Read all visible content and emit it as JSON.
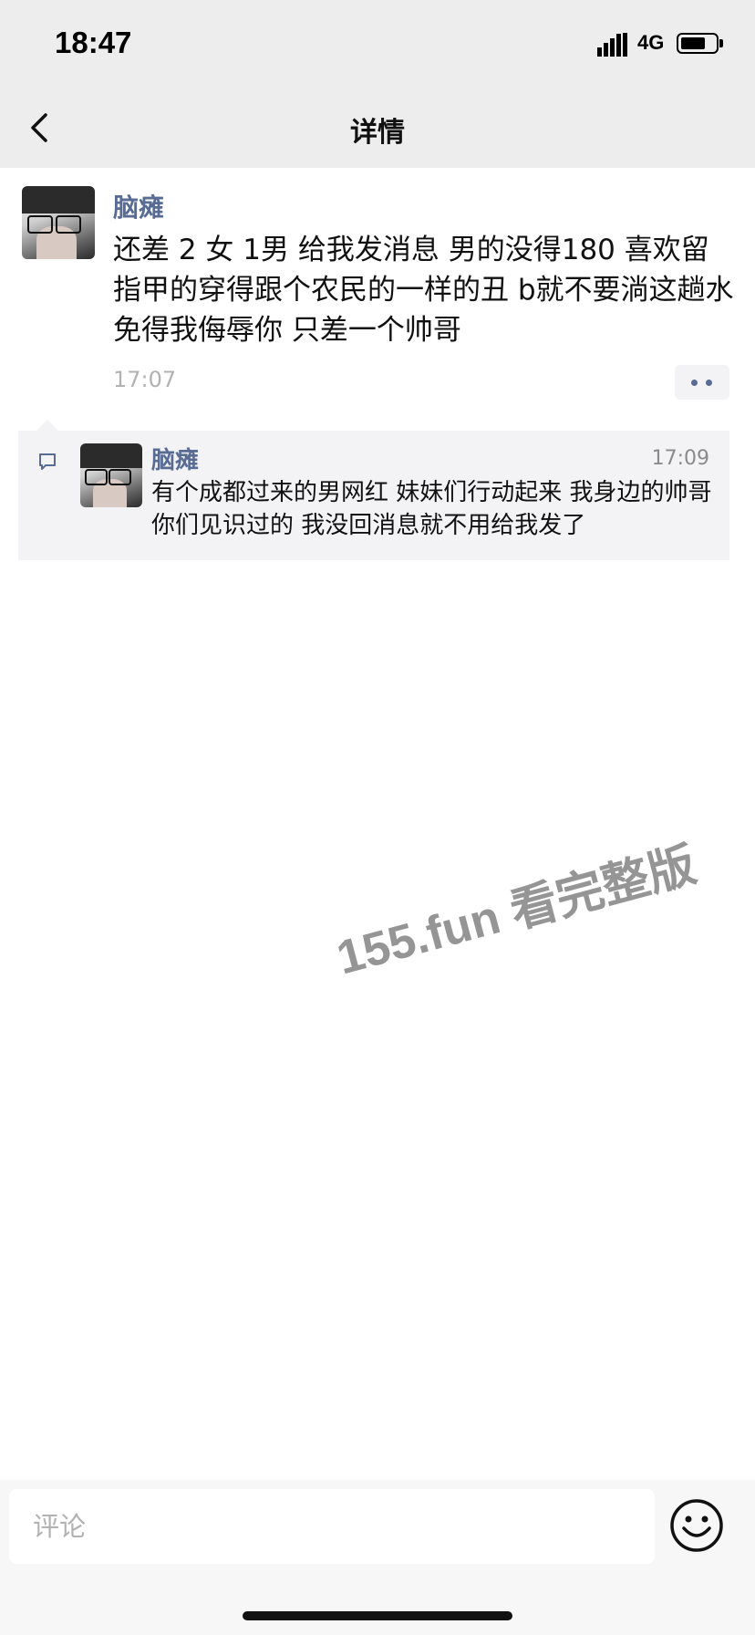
{
  "status_bar": {
    "time": "18:47",
    "network": "4G",
    "signal_icon": "signal-bars-icon",
    "battery_icon": "battery-icon"
  },
  "nav": {
    "title": "详情",
    "back_icon": "chevron-left-icon"
  },
  "post": {
    "author": "脑瘫",
    "content": "还差 2 女 1男 给我发消息 男的没得180 喜欢留指甲的穿得跟个农民的一样的丑 b就不要淌这趟水 免得我侮辱你  只差一个帅哥",
    "time": "17:07",
    "more_icon": "more-dots-icon"
  },
  "comments": [
    {
      "author": "脑瘫",
      "time": "17:09",
      "text": "有个成都过来的男网红 妹妹们行动起来 我身边的帅哥你们见识过的  我没回消息就不用给我发了"
    }
  ],
  "watermark": "155.fun 看完整版",
  "comment_bar": {
    "placeholder": "评论",
    "emoji_icon": "emoji-smile-icon"
  },
  "colors": {
    "header_bg": "#ededed",
    "link_blue": "#576b95",
    "comment_bg": "#f3f3f5",
    "muted_text": "#b2b2b2"
  }
}
